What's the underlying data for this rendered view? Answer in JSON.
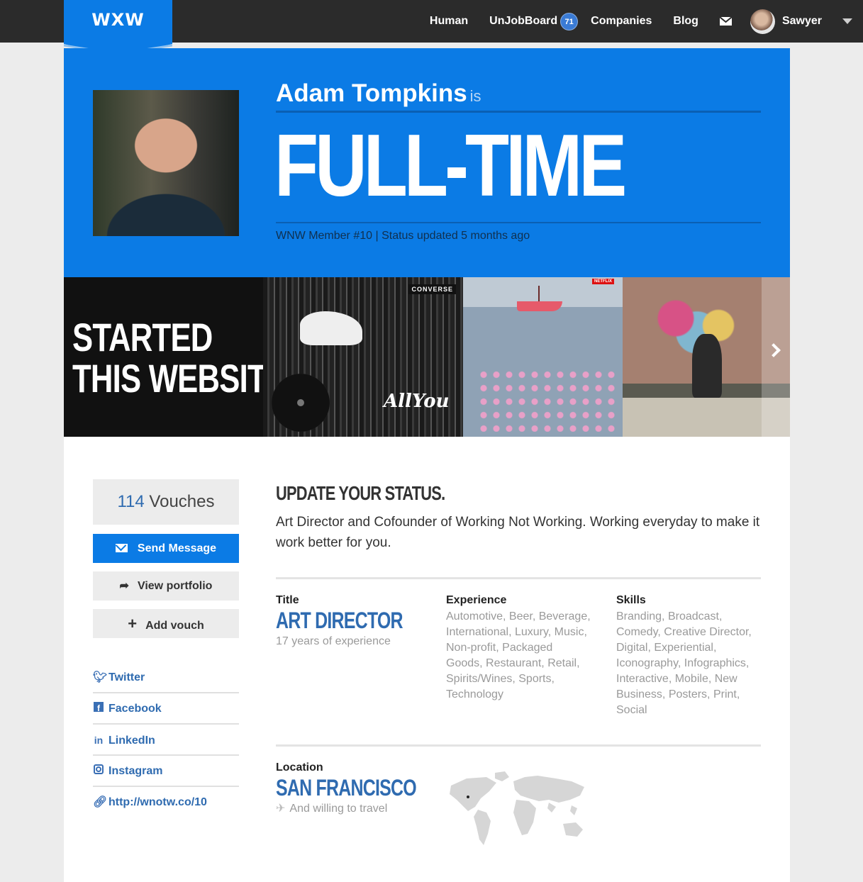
{
  "nav": {
    "logo": "WXW",
    "items": [
      {
        "label": "Human"
      },
      {
        "label": "UnJobBoard",
        "badge": "71"
      },
      {
        "label": "Companies"
      },
      {
        "label": "Blog"
      }
    ],
    "user": "Sawyer"
  },
  "hero": {
    "name": "Adam Tompkins",
    "is": "is",
    "status": "FULL-TIME",
    "meta": "WNW Member #10 | Status updated 5 months ago"
  },
  "gallery": {
    "caption_line1": "STARTED",
    "caption_line2": "THIS WEBSITE",
    "brand": "CONVERSE",
    "sign": "AllYou",
    "logo": "NETFLIX"
  },
  "sidebar": {
    "vouch_count": "114",
    "vouch_label": "Vouches",
    "send_message": "Send Message",
    "view_portfolio": "View portfolio",
    "add_vouch": "Add vouch",
    "social": [
      {
        "label": "Twitter"
      },
      {
        "label": "Facebook"
      },
      {
        "label": "LinkedIn"
      },
      {
        "label": "Instagram"
      },
      {
        "label": "http://wnotw.co/10"
      }
    ]
  },
  "main": {
    "update_title": "UPDATE YOUR STATUS.",
    "bio": "Art Director and Cofounder of Working Not Working. Working everyday to make it work better for you.",
    "title_label": "Title",
    "title_value": "ART DIRECTOR",
    "title_sub": "17 years of experience",
    "experience_label": "Experience",
    "experience_tags": "Automotive, Beer, Beverage, International, Luxury, Music, Non-profit, Packaged Goods, Restaurant, Retail, Spirits/Wines, Sports, Technology",
    "skills_label": "Skills",
    "skills_tags": "Branding, Broadcast, Comedy, Creative Director, Digital, Experiential, Iconography, Infographics, Interactive, Mobile, New Business, Posters, Print, Social",
    "location_label": "Location",
    "location_value": "SAN FRANCISCO",
    "location_sub": "And willing to travel"
  },
  "colors": {
    "brand_blue": "#0b7be5",
    "link_blue": "#2f6bb0",
    "topbar": "#2b2b2b"
  }
}
